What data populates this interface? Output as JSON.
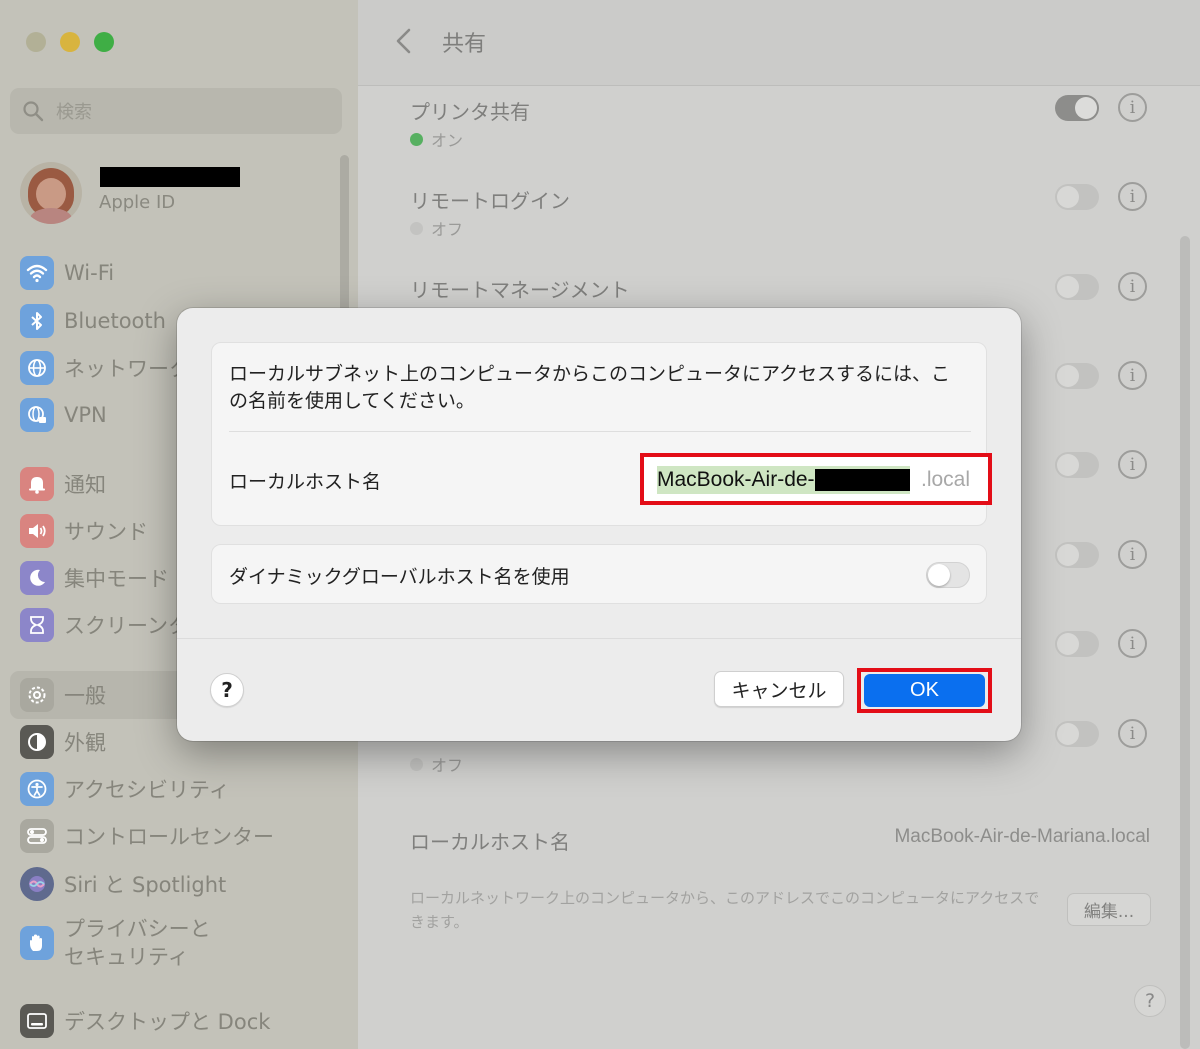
{
  "window": {
    "traffic_lights": [
      "close",
      "minimize",
      "zoom"
    ]
  },
  "sidebar": {
    "search_placeholder": "検索",
    "apple_id_label": "Apple ID",
    "items": [
      {
        "label": "Wi-Fi",
        "icon": "wifi-icon",
        "color": "#3d8ff2"
      },
      {
        "label": "Bluetooth",
        "icon": "bluetooth-icon",
        "color": "#3d8ff2"
      },
      {
        "label": "ネットワーク",
        "icon": "network-globe-icon",
        "color": "#3d8ff2"
      },
      {
        "label": "VPN",
        "icon": "vpn-globe-icon",
        "color": "#3d8ff2"
      },
      {
        "label": "通知",
        "icon": "notification-bell-icon",
        "color": "#e6504a"
      },
      {
        "label": "サウンド",
        "icon": "sound-speaker-icon",
        "color": "#e6504a"
      },
      {
        "label": "集中モード",
        "icon": "focus-moon-icon",
        "color": "#6b5fd6"
      },
      {
        "label": "スクリーンタイム",
        "icon": "screen-time-hourglass-icon",
        "color": "#6b5fd6"
      },
      {
        "label": "一般",
        "icon": "general-gear-icon",
        "color": "#9a9a96",
        "selected": true
      },
      {
        "label": "外観",
        "icon": "appearance-icon",
        "color": "#2c2c2c"
      },
      {
        "label": "アクセシビリティ",
        "icon": "accessibility-icon",
        "color": "#3d8ff2"
      },
      {
        "label": "コントロールセンター",
        "icon": "control-center-icon",
        "color": "#9a9a96"
      },
      {
        "label": "Siri と Spotlight",
        "icon": "siri-icon",
        "color": "#7c5fd0"
      },
      {
        "label": "プライバシーと\nセキュリティ",
        "icon": "privacy-hand-icon",
        "color": "#3d8ff2"
      },
      {
        "label": "デスクトップと Dock",
        "icon": "desktop-dock-icon",
        "color": "#2c2c2c"
      }
    ]
  },
  "main": {
    "title": "共有",
    "rows": [
      {
        "label": "プリンタ共有",
        "status": "オン",
        "on": true
      },
      {
        "label": "リモートログイン",
        "status": "オフ",
        "on": false
      },
      {
        "label": "リモートマネージメント",
        "status": "",
        "on": false
      },
      {
        "label": "",
        "status": "",
        "on": false
      },
      {
        "label": "",
        "status": "",
        "on": false
      },
      {
        "label": "",
        "status": "",
        "on": false
      },
      {
        "label": "",
        "status": "",
        "on": false
      },
      {
        "label": "",
        "status": "オフ",
        "on": false
      }
    ],
    "local_hostname_label": "ローカルホスト名",
    "local_hostname_value": "MacBook-Air-de-Mariana.local",
    "local_hostname_desc": "ローカルネットワーク上のコンピュータから、このアドレスでこのコンピュータにアクセスできます。",
    "edit_button": "編集...",
    "help_button": "?"
  },
  "dialog": {
    "description": "ローカルサブネット上のコンピュータからこのコンピュータにアクセスするには、この名前を使用してください。",
    "hostname_label": "ローカルホスト名",
    "hostname_prefix": "MacBook-Air-de-",
    "hostname_suffix": ".local",
    "dynamic_label": "ダイナミックグローバルホスト名を使用",
    "dynamic_on": false,
    "help_button": "?",
    "cancel_button": "キャンセル",
    "ok_button": "OK",
    "highlight_color": "#e30d17",
    "accent_color": "#0a6fef"
  }
}
